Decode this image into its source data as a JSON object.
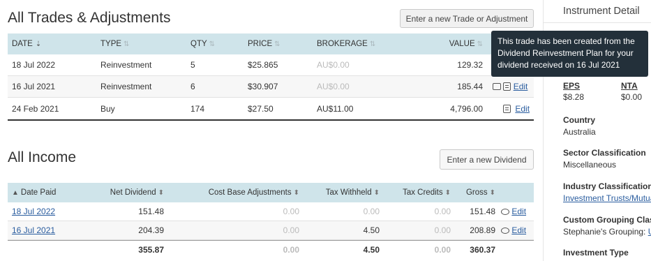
{
  "trades": {
    "title": "All Trades & Adjustments",
    "new_button": "Enter a new Trade or Adjustment",
    "headers": {
      "date": "DATE",
      "type": "TYPE",
      "qty": "QTY",
      "price": "PRICE",
      "brokerage": "BROKERAGE",
      "value": "VALUE"
    },
    "rows": [
      {
        "date": "18 Jul 2022",
        "type": "Reinvestment",
        "qty": "5",
        "price": "$25.865",
        "brokerage": "AU$0.00",
        "value": "129.32",
        "edit": ""
      },
      {
        "date": "16 Jul 2021",
        "type": "Reinvestment",
        "qty": "6",
        "price": "$30.907",
        "brokerage": "AU$0.00",
        "value": "185.44",
        "edit": "Edit"
      },
      {
        "date": "24 Feb 2021",
        "type": "Buy",
        "qty": "174",
        "price": "$27.50",
        "brokerage": "AU$11.00",
        "value": "4,796.00",
        "edit": "Edit"
      }
    ]
  },
  "tooltip": {
    "text": "This trade has been created from the Dividend Reinvestment Plan for your dividend received on 16 Jul 2021"
  },
  "income": {
    "title": "All Income",
    "new_button": "Enter a new Dividend",
    "headers": {
      "date_paid": "Date Paid",
      "net_dividend": "Net Dividend",
      "cost_base": "Cost Base Adjustments",
      "tax_withheld": "Tax Withheld",
      "tax_credits": "Tax Credits",
      "gross": "Gross"
    },
    "rows": [
      {
        "date_paid": "18 Jul 2022",
        "net_dividend": "151.48",
        "cost_base": "0.00",
        "tax_withheld": "0.00",
        "tax_credits": "0.00",
        "gross": "151.48",
        "edit": "Edit"
      },
      {
        "date_paid": "16 Jul 2021",
        "net_dividend": "204.39",
        "cost_base": "0.00",
        "tax_withheld": "4.50",
        "tax_credits": "0.00",
        "gross": "208.89",
        "edit": "Edit"
      }
    ],
    "totals": {
      "net_dividend": "355.87",
      "cost_base": "0.00",
      "tax_withheld": "4.50",
      "tax_credits": "0.00",
      "gross": "360.37"
    }
  },
  "sidebar": {
    "title": "Instrument Detail",
    "eps_label": "EPS",
    "eps_value": "$8.28",
    "nta_label": "NTA",
    "nta_value": "$0.00",
    "country_label": "Country",
    "country_value": "Australia",
    "sector_label": "Sector Classification",
    "sector_value": "Miscellaneous",
    "industry_label": "Industry Classification",
    "industry_value": "Investment Trusts/Mutua",
    "custom_label": "Custom Grouping Clas",
    "custom_value": "Stephanie's Grouping:",
    "custom_link": "U",
    "investment_type_label": "Investment Type"
  }
}
